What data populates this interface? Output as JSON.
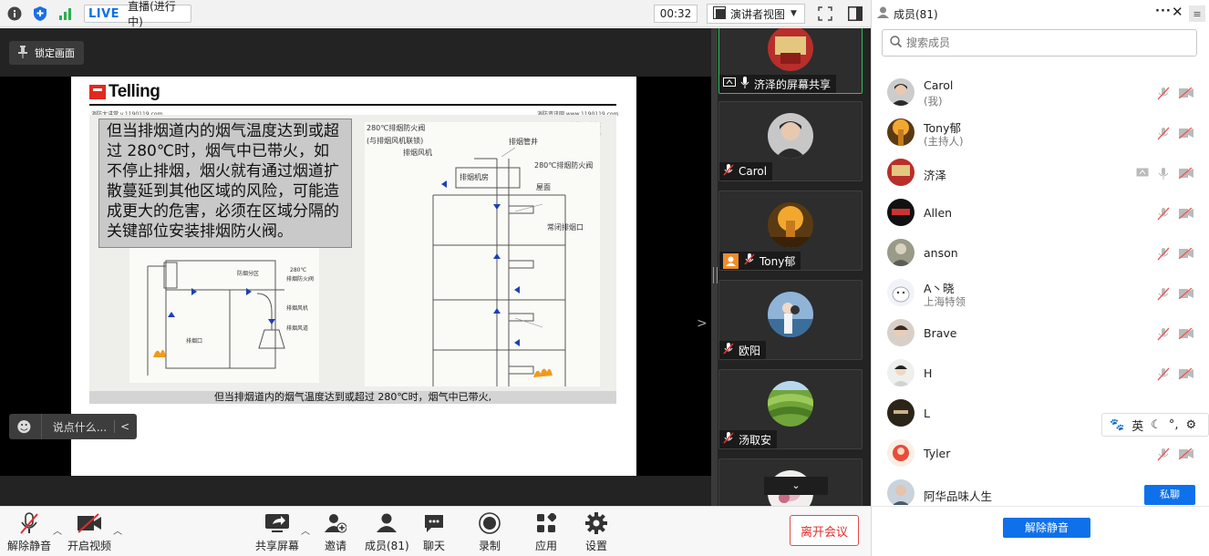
{
  "topbar": {
    "live": "LIVE",
    "status": "直播(进行中)",
    "timer": "00:32",
    "view_label": "演讲者视图"
  },
  "main": {
    "lock_label": "锁定画面",
    "chat_placeholder": "说点什么...",
    "slide": {
      "logo": "Telling",
      "header_left": "消防大讲堂 v.1190119.com",
      "header_right": "消防资讯网 www.1190119.com",
      "watermark": "磐 龍",
      "body_text": "但当排烟道内的烟气温度达到或超过 280℃时，烟气中已带火，如不停止排烟，烟火就有通过烟道扩散蔓延到其他区域的风险，可能造成更大的危害，必须在区域分隔的关键部位安装排烟防火阀。",
      "caption": "但当排烟道内的烟气温度达到或超过 280℃时，烟气中已带火,",
      "diagram_labels": [
        "280℃排烟防火阀",
        "(与排烟风机联锁)",
        "排烟风机",
        "排烟管井",
        "排烟机房",
        "280℃排烟防火阀",
        "屋面",
        "常闭排烟口",
        "280℃",
        "排烟防火阀",
        "防烟分区",
        "排烟风机",
        "排烟风道",
        "排烟口"
      ]
    }
  },
  "thumbs": [
    {
      "name": "济泽的屏幕共享",
      "active": true
    },
    {
      "name": "Carol",
      "active": false
    },
    {
      "name": "Tony郁",
      "active": false
    },
    {
      "name": "欧阳",
      "active": false
    },
    {
      "name": "汤取安",
      "active": false
    },
    {
      "name": "",
      "active": false
    }
  ],
  "toolbar": {
    "unmute": "解除静音",
    "video": "开启视频",
    "share": "共享屏幕",
    "invite": "邀请",
    "members": "成员(81)",
    "chat": "聊天",
    "record": "录制",
    "apps": "应用",
    "settings": "设置",
    "leave": "离开会议"
  },
  "panel": {
    "title": "成员(81)",
    "search_placeholder": "搜索成员",
    "members": [
      {
        "name": "Carol",
        "sub": "(我)"
      },
      {
        "name": "Tony郁",
        "sub": "(主持人)"
      },
      {
        "name": "济泽",
        "sub": ""
      },
      {
        "name": "Allen",
        "sub": ""
      },
      {
        "name": "anson",
        "sub": ""
      },
      {
        "name": "A丶晓",
        "sub": "上海特领"
      },
      {
        "name": "Brave",
        "sub": ""
      },
      {
        "name": "H",
        "sub": ""
      },
      {
        "name": "L",
        "sub": ""
      },
      {
        "name": "Tyler",
        "sub": ""
      },
      {
        "name": "阿华品味人生",
        "sub": ""
      }
    ],
    "private_chat": "私聊",
    "unmute_all": "解除静音",
    "ime_lang": "英"
  }
}
